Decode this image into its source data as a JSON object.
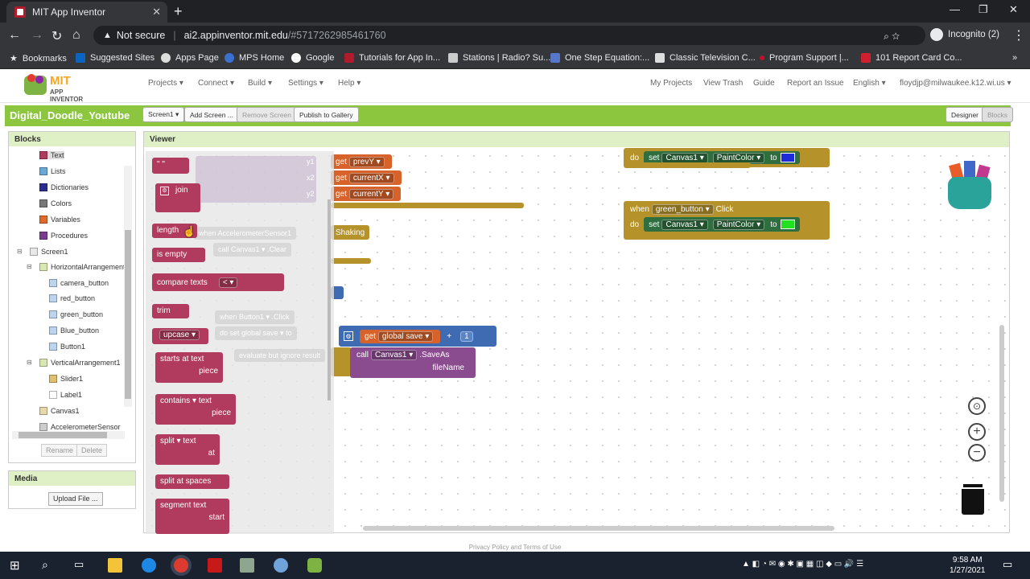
{
  "browser": {
    "tab_title": "MIT App Inventor",
    "not_secure": "Not secure",
    "url_host": "ai2.appinventor.mit.edu",
    "url_path": "/#5717262985461760",
    "profile": "Incognito (2)"
  },
  "bookmarks": [
    "Bookmarks",
    "Suggested Sites",
    "Apps Page",
    "MPS Home",
    "Google",
    "Tutorials for App In...",
    "Stations | Radio? Su...",
    "One Step Equation:...",
    "Classic Television C...",
    "Program Support |...",
    "101 Report Card Co..."
  ],
  "header": {
    "logo_title": "MIT",
    "logo_sub": "APP INVENTOR",
    "menus": [
      "Projects ▾",
      "Connect ▾",
      "Build ▾",
      "Settings ▾",
      "Help ▾"
    ],
    "right": [
      "My Projects",
      "View Trash",
      "Guide",
      "Report an Issue",
      "English ▾",
      "floydjp@milwaukee.k12.wi.us ▾"
    ]
  },
  "project": {
    "name": "Digital_Doodle_Youtube",
    "screen_btn": "Screen1 ▾",
    "add_screen": "Add Screen ...",
    "remove_screen": "Remove Screen",
    "publish": "Publish to Gallery",
    "designer": "Designer",
    "blocks": "Blocks"
  },
  "blocks_panel": {
    "title": "Blocks",
    "builtins": [
      {
        "label": "Text",
        "color": "#b03b5e"
      },
      {
        "label": "Lists",
        "color": "#6aa8d8"
      },
      {
        "label": "Dictionaries",
        "color": "#2d2d8f"
      },
      {
        "label": "Colors",
        "color": "#777777"
      },
      {
        "label": "Variables",
        "color": "#e06a2a"
      },
      {
        "label": "Procedures",
        "color": "#7a3c8f"
      }
    ],
    "tree": [
      "Screen1",
      "HorizontalArrangement",
      "camera_button",
      "red_button",
      "green_button",
      "Blue_button",
      "Button1",
      "VerticalArrangement1",
      "Slider1",
      "Label1",
      "Canvas1",
      "AccelerometerSensor"
    ],
    "rename": "Rename",
    "delete": "Delete"
  },
  "media_panel": {
    "title": "Media",
    "upload": "Upload File ..."
  },
  "viewer": {
    "title": "Viewer"
  },
  "flyout": {
    "blocks": [
      "\" \"",
      "join",
      "length",
      "is empty",
      "compare texts",
      "trim",
      "upcase ▾",
      "starts at  text",
      "piece",
      "contains ▾  text",
      "piece",
      "split ▾  text",
      "at",
      "split at spaces",
      "segment  text",
      "start"
    ],
    "compare_op": "< ▾"
  },
  "ws": {
    "get_prevY": "get",
    "prevY": "prevY ▾",
    "get_currentX": "get",
    "currentX": "currentX ▾",
    "get_currentY": "get",
    "currentY": "currentY ▾",
    "shaking": "Shaking",
    "ghost_accel": "when  AccelerometerSensor1",
    "ghost_call": "call  Canvas1 ▾ .Clear",
    "ghost_when": "when  Button1 ▾ .Click",
    "ghost_do": "do  set  global save ▾  to",
    "ghost_eval": "evaluate but ignore result",
    "y1": "y1",
    "x2": "x2",
    "y2": "y2",
    "get_global": "get",
    "global_save": "global save ▾",
    "plus": "+",
    "one": "1",
    "call": "call",
    "canvas_saveas": "Canvas1 ▾",
    "saveas": ".SaveAs",
    "filename": "fileName",
    "top_set": "set",
    "top_canvas": "Canvas1 ▾",
    "top_prop": "PaintColor ▾",
    "top_to": "to",
    "top_do": "do",
    "when": "when",
    "green_button": "green_button ▾",
    "click": "Click",
    "do": "do",
    "set": "set",
    "canvas": "Canvas1 ▾",
    "paintcolor": "PaintColor ▾",
    "to": "to",
    "blue_color": "#1d2bd9",
    "green_color": "#22e022"
  },
  "footer": "Privacy Policy and Terms of Use",
  "clock": {
    "time": "9:58 AM",
    "date": "1/27/2021"
  }
}
